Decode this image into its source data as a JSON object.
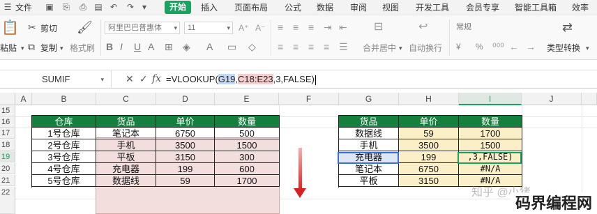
{
  "menu": {
    "file": "文件",
    "tabs": [
      "开始",
      "插入",
      "页面布局",
      "公式",
      "数据",
      "审阅",
      "视图",
      "开发工具",
      "会员专享",
      "智能工具箱",
      "效率"
    ]
  },
  "ribbon": {
    "paste": "粘贴",
    "cut": "剪切",
    "copy": "复制",
    "format_painter": "格式刷",
    "font_name": "阿里巴巴普惠体",
    "font_size": "11",
    "merge_center": "合并居中",
    "wrap_text": "自动换行",
    "number_format": "常规",
    "currency": "¥",
    "percent": "%",
    "type_convert": "类型转换"
  },
  "formula_bar": {
    "name_box": "SUMIF",
    "cancel": "✕",
    "confirm": "✓",
    "fx": "fx",
    "formula_prefix": "=VLOOKUP(",
    "arg1": "G19",
    "comma1": ",",
    "arg2": "C18:E23",
    "formula_suffix": ",3,FALSE)"
  },
  "columns": [
    "A",
    "B",
    "C",
    "D",
    "E",
    "F",
    "G",
    "H",
    "I",
    "J"
  ],
  "rows": [
    "15",
    "16",
    "17",
    "18",
    "19",
    "20",
    "21",
    "22"
  ],
  "left_table": {
    "headers": [
      "仓库",
      "货品",
      "单价",
      "数量"
    ],
    "rows": [
      [
        "1号仓库",
        "笔记本",
        "6750",
        "500"
      ],
      [
        "2号仓库",
        "手机",
        "3500",
        "1500"
      ],
      [
        "3号仓库",
        "平板",
        "3150",
        "300"
      ],
      [
        "4号仓库",
        "充电器",
        "199",
        "600"
      ],
      [
        "5号仓库",
        "数据线",
        "59",
        "1700"
      ]
    ]
  },
  "right_table": {
    "headers": [
      "货品",
      "单价",
      "数量"
    ],
    "rows": [
      [
        "数据线",
        "59",
        "1700"
      ],
      [
        "手机",
        "3500",
        "1500"
      ],
      [
        "充电器",
        "199",
        ",3,FALSE)"
      ],
      [
        "笔记本",
        "6750",
        "#N/A"
      ],
      [
        "平板",
        "3150",
        "#N/A"
      ]
    ]
  },
  "watermark": {
    "site": "码界编程网",
    "zhihu": "知乎 @小猪"
  },
  "colors": {
    "accent": "#1aa260",
    "header_green": "#15803d",
    "range_pink": "#f3dede",
    "result_yellow": "#fbefc8",
    "arrow_red": "#d82020"
  }
}
